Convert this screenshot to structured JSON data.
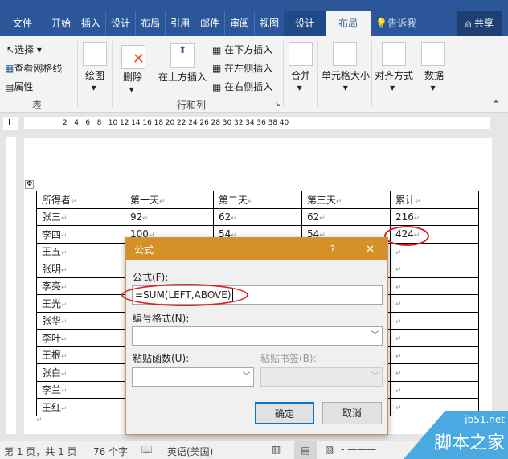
{
  "tabs": [
    "文件",
    "开始",
    "插入",
    "设计",
    "布局",
    "引用",
    "邮件",
    "审阅",
    "视图"
  ],
  "context_tabs": [
    "设计",
    "布局"
  ],
  "tell_me": "告诉我",
  "share": "共享",
  "ribbon": {
    "select": "选择",
    "gridlines": "查看网格线",
    "properties": "属性",
    "group_table": "表",
    "draw": "绘图",
    "delete": "删除",
    "insert_above": "在上方插入",
    "insert_below": "在下方插入",
    "insert_left": "在左侧插入",
    "insert_right": "在右侧插入",
    "group_rows_cols": "行和列",
    "merge": "合并",
    "cell_size": "单元格大小",
    "alignment": "对齐方式",
    "data": "数据"
  },
  "ruler": [
    "2",
    "4",
    "6",
    "8",
    "10",
    "12",
    "14",
    "16",
    "18",
    "20",
    "22",
    "24",
    "26",
    "28",
    "30",
    "32",
    "34",
    "36",
    "38",
    "40"
  ],
  "table": {
    "headers": [
      "所得者",
      "第一天",
      "第二天",
      "第三天",
      "累计"
    ],
    "rows": [
      [
        "张三",
        "92",
        "62",
        "62",
        "216"
      ],
      [
        "李四",
        "100",
        "54",
        "54",
        "424"
      ],
      [
        "王五",
        "",
        "",
        "",
        ""
      ],
      [
        "张明",
        "",
        "",
        "",
        ""
      ],
      [
        "李亮",
        "",
        "",
        "",
        ""
      ],
      [
        "王光",
        "",
        "",
        "",
        ""
      ],
      [
        "张华",
        "",
        "",
        "",
        ""
      ],
      [
        "李叶",
        "",
        "",
        "",
        ""
      ],
      [
        "王根",
        "",
        "",
        "",
        ""
      ],
      [
        "张白",
        "",
        "",
        "",
        ""
      ],
      [
        "李兰",
        "",
        "",
        "",
        ""
      ],
      [
        "王红",
        "",
        "",
        "",
        ""
      ]
    ]
  },
  "dialog": {
    "title": "公式",
    "help": "?",
    "close": "✕",
    "formula_label": "公式(F):",
    "formula_value": "=SUM(LEFT,ABOVE)",
    "number_format_label": "编号格式(N):",
    "paste_function_label": "粘贴函数(U):",
    "paste_bookmark_label": "粘贴书签(B):",
    "ok": "确定",
    "cancel": "取消"
  },
  "status": {
    "page": "第 1 页，共 1 页",
    "words": "76 个字",
    "language": "英语(美国)"
  },
  "watermark": {
    "site": "jb51.net",
    "name": "脚本之家"
  }
}
